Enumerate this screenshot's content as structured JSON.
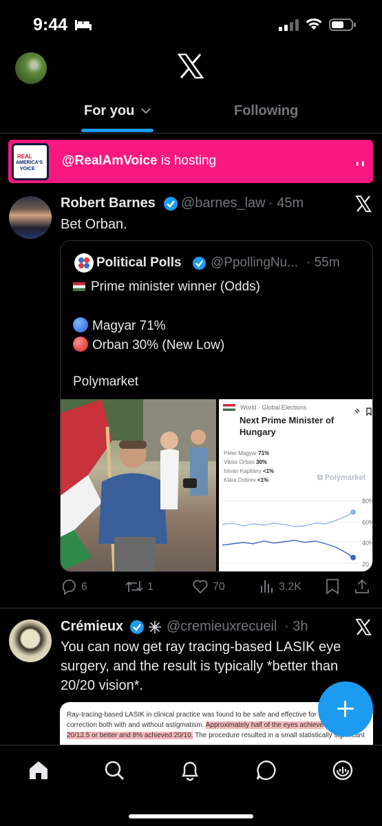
{
  "status_bar": {
    "time": "9:44"
  },
  "header": {
    "logo": "x-logo-icon"
  },
  "tabs": [
    {
      "label": "For you",
      "active": true
    },
    {
      "label": "Following",
      "active": false
    }
  ],
  "spaces_banner": {
    "handle": "@RealAmVoice",
    "text": " is hosting",
    "avatar_text": {
      "line1": "REAL",
      "line2": "AMERICA'S",
      "line3": "VOICE"
    },
    "color": "#f91880"
  },
  "tweets": [
    {
      "name": "Robert Barnes",
      "handle": "@barnes_law",
      "time": "· 45m",
      "text": "Bet Orban.",
      "quote": {
        "name": "Political Polls",
        "handle": "@PpollingNu...",
        "time": "· 55m",
        "lines": [
          "Prime minister winner (Odds)",
          "Magyar 71%",
          "Orban 30% (New Low)",
          "Polymarket"
        ],
        "image_card": {
          "breadcrumb": "World · Global Elections",
          "title": "Next Prime Minister of Hungary",
          "rows": [
            {
              "name": "Péter Magyar",
              "value": "71%"
            },
            {
              "name": "Viktor Orbán",
              "value": "30%"
            },
            {
              "name": "István Kapitány",
              "value": "<1%"
            },
            {
              "name": "Klára Dobrev",
              "value": "<1%"
            }
          ],
          "brand": "Polymarket",
          "axis_labels": [
            "80%",
            "60%",
            "40%",
            "20"
          ]
        }
      },
      "actions": {
        "replies": "6",
        "reposts": "1",
        "likes": "70",
        "views": "3.2K"
      }
    },
    {
      "name": "Crémieux",
      "handle": "@cremieuxrecueil",
      "time": "· 3h",
      "text": "You can now get ray tracing-based LASIK eye surgery, and the result is typically *better than 20/20 vision*.",
      "card_lines": [
        {
          "plain": "Ray-tracing-based LASIK in clinical practice was found to be safe and effective for r",
          "hl": ""
        },
        {
          "plain": "correction both with and without astigmatism. ",
          "hl": "Approximately half of the eyes achieve"
        },
        {
          "plain": "",
          "hl": "20/12.5 or better and 8% achieved 20/10.",
          "tail": " The procedure resulted in a small statistically significant"
        }
      ]
    }
  ],
  "accent": "#1d9bf0"
}
